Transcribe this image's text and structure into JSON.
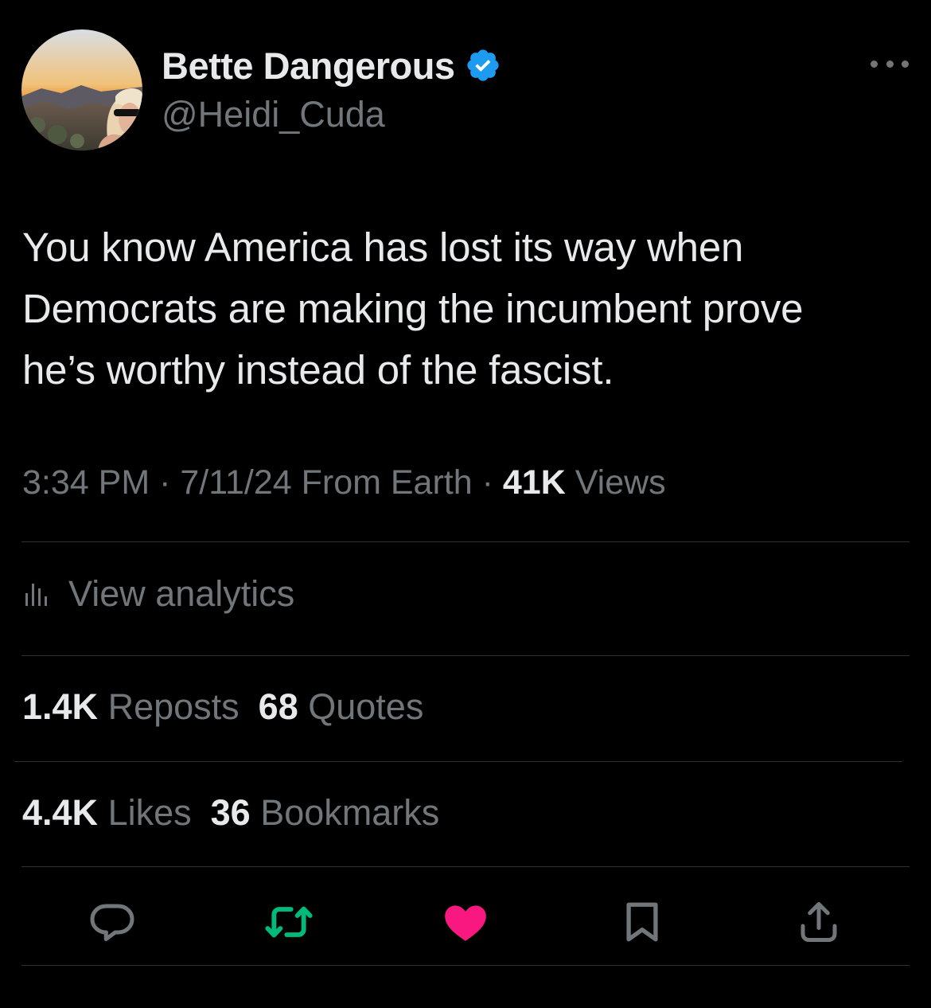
{
  "author": {
    "display_name": "Bette Dangerous",
    "handle": "@Heidi_Cuda",
    "verified": true
  },
  "tweet": {
    "text_lines": [
      "You know America has lost its way when",
      "Democrats are making the incumbent prove",
      "he’s worthy instead of the fascist."
    ]
  },
  "meta": {
    "time": "3:34 PM",
    "separator": "·",
    "date": "7/11/24",
    "source": "From Earth",
    "views_count": "41K",
    "views_label": "Views"
  },
  "analytics": {
    "label": "View analytics",
    "icon": "bar-chart-icon"
  },
  "stats": {
    "reposts_count": "1.4K",
    "reposts_label": "Reposts",
    "quotes_count": "68",
    "quotes_label": "Quotes",
    "likes_count": "4.4K",
    "likes_label": "Likes",
    "bookmarks_count": "36",
    "bookmarks_label": "Bookmarks"
  },
  "actions": [
    {
      "icon": "reply-icon",
      "color": "#71767b"
    },
    {
      "icon": "repost-icon",
      "color": "#00ba7c",
      "active": true
    },
    {
      "icon": "heart-icon",
      "color": "#f91880",
      "active": true
    },
    {
      "icon": "bookmark-icon",
      "color": "#71767b"
    },
    {
      "icon": "share-icon",
      "color": "#71767b"
    }
  ],
  "colors": {
    "background": "#000000",
    "primary_text": "#e7e9ea",
    "secondary_text": "#71767b",
    "divider": "#2f3336",
    "verified_badge": "#1d9bf0",
    "like": "#f91880",
    "repost": "#00ba7c"
  }
}
